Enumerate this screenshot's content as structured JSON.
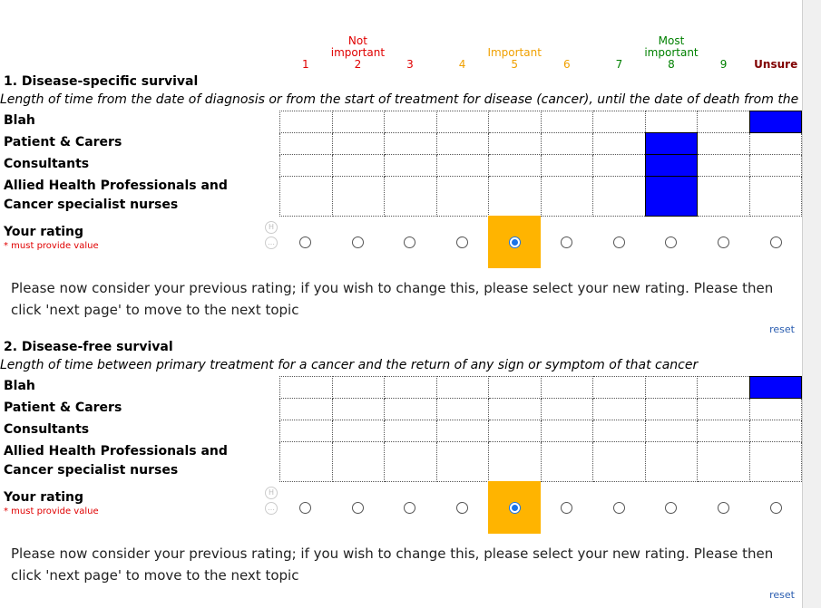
{
  "scale": {
    "labels": [
      {
        "top": "",
        "num": "1",
        "color": "red"
      },
      {
        "top": "Not\nimportant",
        "num": "2",
        "color": "red"
      },
      {
        "top": "",
        "num": "3",
        "color": "red"
      },
      {
        "top": "",
        "num": "4",
        "color": "orange"
      },
      {
        "top": "Important",
        "num": "5",
        "color": "orange"
      },
      {
        "top": "",
        "num": "6",
        "color": "orange"
      },
      {
        "top": "",
        "num": "7",
        "color": "green"
      },
      {
        "top": "Most\nimportant",
        "num": "8",
        "color": "green"
      },
      {
        "top": "",
        "num": "9",
        "color": "green"
      },
      {
        "top": "",
        "num": "Unsure",
        "color": "maroon"
      }
    ]
  },
  "sections": [
    {
      "title": "1. Disease-specific survival",
      "description": "Length of time from the date of diagnosis or from the start of treatment for disease (cancer), until the date of death from the disease",
      "groups": [
        {
          "label": "Blah",
          "selected": 9
        },
        {
          "label": "Patient & Carers",
          "selected": 7
        },
        {
          "label": "Consultants",
          "selected": 7
        },
        {
          "label": "Allied Health Professionals and Cancer specialist nurses",
          "selected": 7
        }
      ],
      "rating_label": "Your rating",
      "required_text": "* must provide value",
      "selected_rating": 4,
      "note": "Please now consider your previous rating; if you wish to change this, please select your new rating. Please then click 'next page' to move to the next topic",
      "reset_label": "reset"
    },
    {
      "title": "2. Disease-free survival",
      "description": "Length of time between primary treatment for a cancer and the return of any sign or symptom of that cancer",
      "groups": [
        {
          "label": "Blah",
          "selected": 9
        },
        {
          "label": "Patient & Carers",
          "selected": -1
        },
        {
          "label": "Consultants",
          "selected": -1
        },
        {
          "label": "Allied Health Professionals and Cancer specialist nurses",
          "selected": -1
        }
      ],
      "rating_label": "Your rating",
      "required_text": "* must provide value",
      "selected_rating": 4,
      "note": "Please now consider your previous rating; if you wish to change this, please select your new rating. Please then click 'next page' to move to the next topic",
      "reset_label": "reset"
    }
  ],
  "icons": {
    "history": "history-icon",
    "comment": "comment-icon"
  },
  "colors": {
    "selected_cell": "#0000ff",
    "selected_rating": "#ffb400",
    "not_important": "#e00000",
    "important": "#f0a000",
    "most_important": "#008000",
    "unsure": "#800000"
  }
}
